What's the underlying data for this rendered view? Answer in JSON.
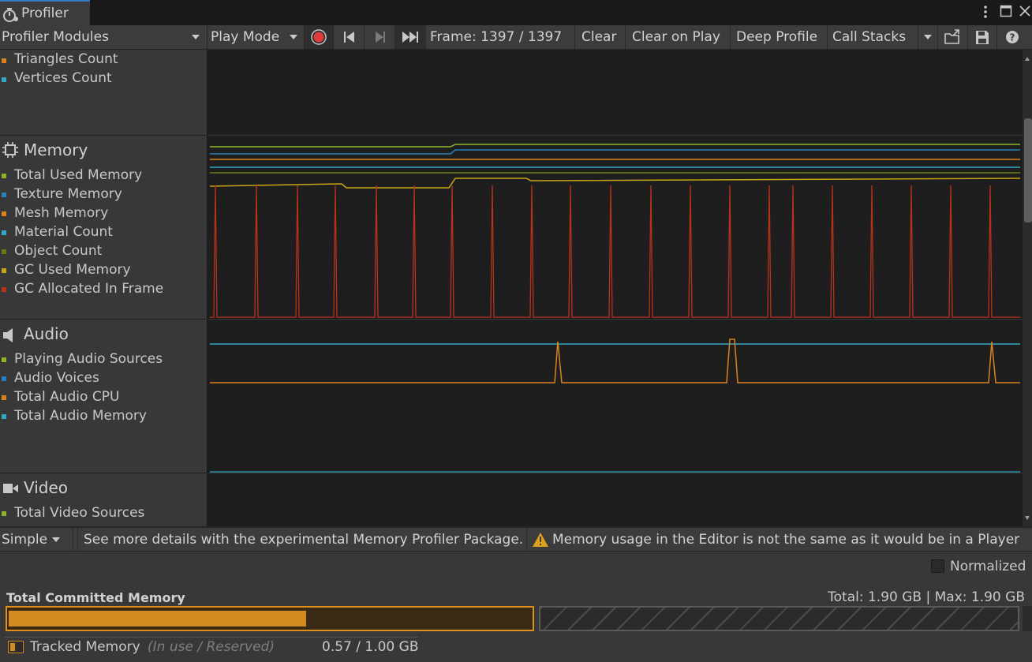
{
  "window": {
    "tab_title": "Profiler",
    "menu_icon": "kebab-menu-icon",
    "maximize_icon": "maximize-icon",
    "close_icon": "close-icon"
  },
  "toolbar": {
    "modules_label": "Profiler Modules",
    "play_mode_label": "Play Mode",
    "frame_label": "Frame: 1397 / 1397",
    "clear_label": "Clear",
    "clear_on_play_label": "Clear on Play",
    "deep_profile_label": "Deep Profile",
    "call_stacks_label": "Call Stacks",
    "record_color": "#e03b3b"
  },
  "modules": {
    "rendering": {
      "items": [
        {
          "label": "Triangles Count",
          "color": "#d9821f"
        },
        {
          "label": "Vertices Count",
          "color": "#33a7c6"
        }
      ]
    },
    "memory": {
      "title": "Memory",
      "items": [
        {
          "label": "Total Used Memory",
          "color": "#8fb52b"
        },
        {
          "label": "Texture Memory",
          "color": "#2a7fba"
        },
        {
          "label": "Mesh Memory",
          "color": "#d9821f"
        },
        {
          "label": "Material Count",
          "color": "#33a7c6"
        },
        {
          "label": "Object Count",
          "color": "#6a7a16"
        },
        {
          "label": "GC Used Memory",
          "color": "#c8a512"
        },
        {
          "label": "GC Allocated In Frame",
          "color": "#b8321a"
        }
      ]
    },
    "audio": {
      "title": "Audio",
      "items": [
        {
          "label": "Playing Audio Sources",
          "color": "#8fb52b"
        },
        {
          "label": "Audio Voices",
          "color": "#2a7fba"
        },
        {
          "label": "Total Audio CPU",
          "color": "#d9821f"
        },
        {
          "label": "Total Audio Memory",
          "color": "#33a7c6"
        }
      ]
    },
    "video": {
      "title": "Video",
      "items": [
        {
          "label": "Total Video Sources",
          "color": "#8fb52b"
        }
      ]
    }
  },
  "detail_bar": {
    "view_mode": "Simple",
    "info_text": "See more details with the experimental Memory Profiler Package.",
    "warning_text": "Memory usage in the Editor is not the same as it would be in a Player"
  },
  "detail": {
    "normalized_label": "Normalized",
    "normalized_checked": false,
    "total_title": "Total Committed Memory",
    "total_summary": "Total: 1.90 GB | Max: 1.90 GB",
    "tracked_label": "Tracked Memory",
    "tracked_hint": "(In use / Reserved)",
    "tracked_value": "0.57 / 1.00 GB",
    "tracked_fraction": 0.57,
    "tracked_color": "#d48a1e"
  }
}
